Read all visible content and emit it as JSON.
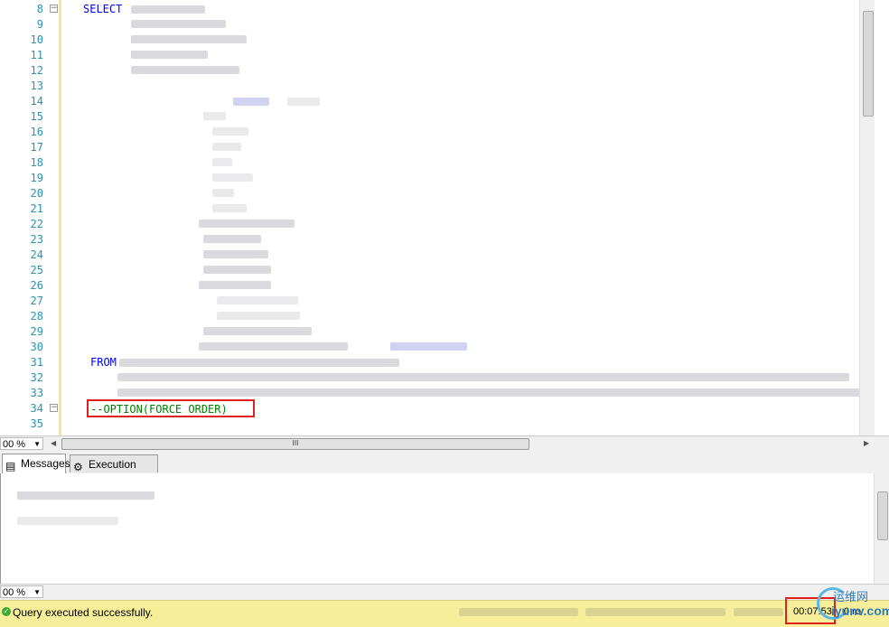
{
  "editor": {
    "line_numbers": [
      "8",
      "9",
      "10",
      "11",
      "12",
      "13",
      "14",
      "15",
      "16",
      "17",
      "18",
      "19",
      "20",
      "21",
      "22",
      "23",
      "24",
      "25",
      "26",
      "27",
      "28",
      "29",
      "30",
      "31",
      "32",
      "33",
      "34",
      "35"
    ],
    "keywords": {
      "select": "SELECT",
      "from": "FROM"
    },
    "comment": "--OPTION(FORCE ORDER)",
    "fold_markers": [
      "−",
      "−"
    ]
  },
  "zoom": {
    "editor": "00 %",
    "results": "00 %"
  },
  "hscroll": {
    "grip": "III"
  },
  "tabs": [
    {
      "label": "Messages",
      "icon": "messages-icon",
      "active": true
    },
    {
      "label": "Execution plan",
      "icon": "execution-plan-icon",
      "active": false
    }
  ],
  "status": {
    "message": "Query executed successfully.",
    "elapsed": "00:07:53",
    "rows": "0 ro",
    "color": "#f7ee9a"
  },
  "watermark": {
    "cn": "运维网",
    "domain": "iyunv.com"
  }
}
